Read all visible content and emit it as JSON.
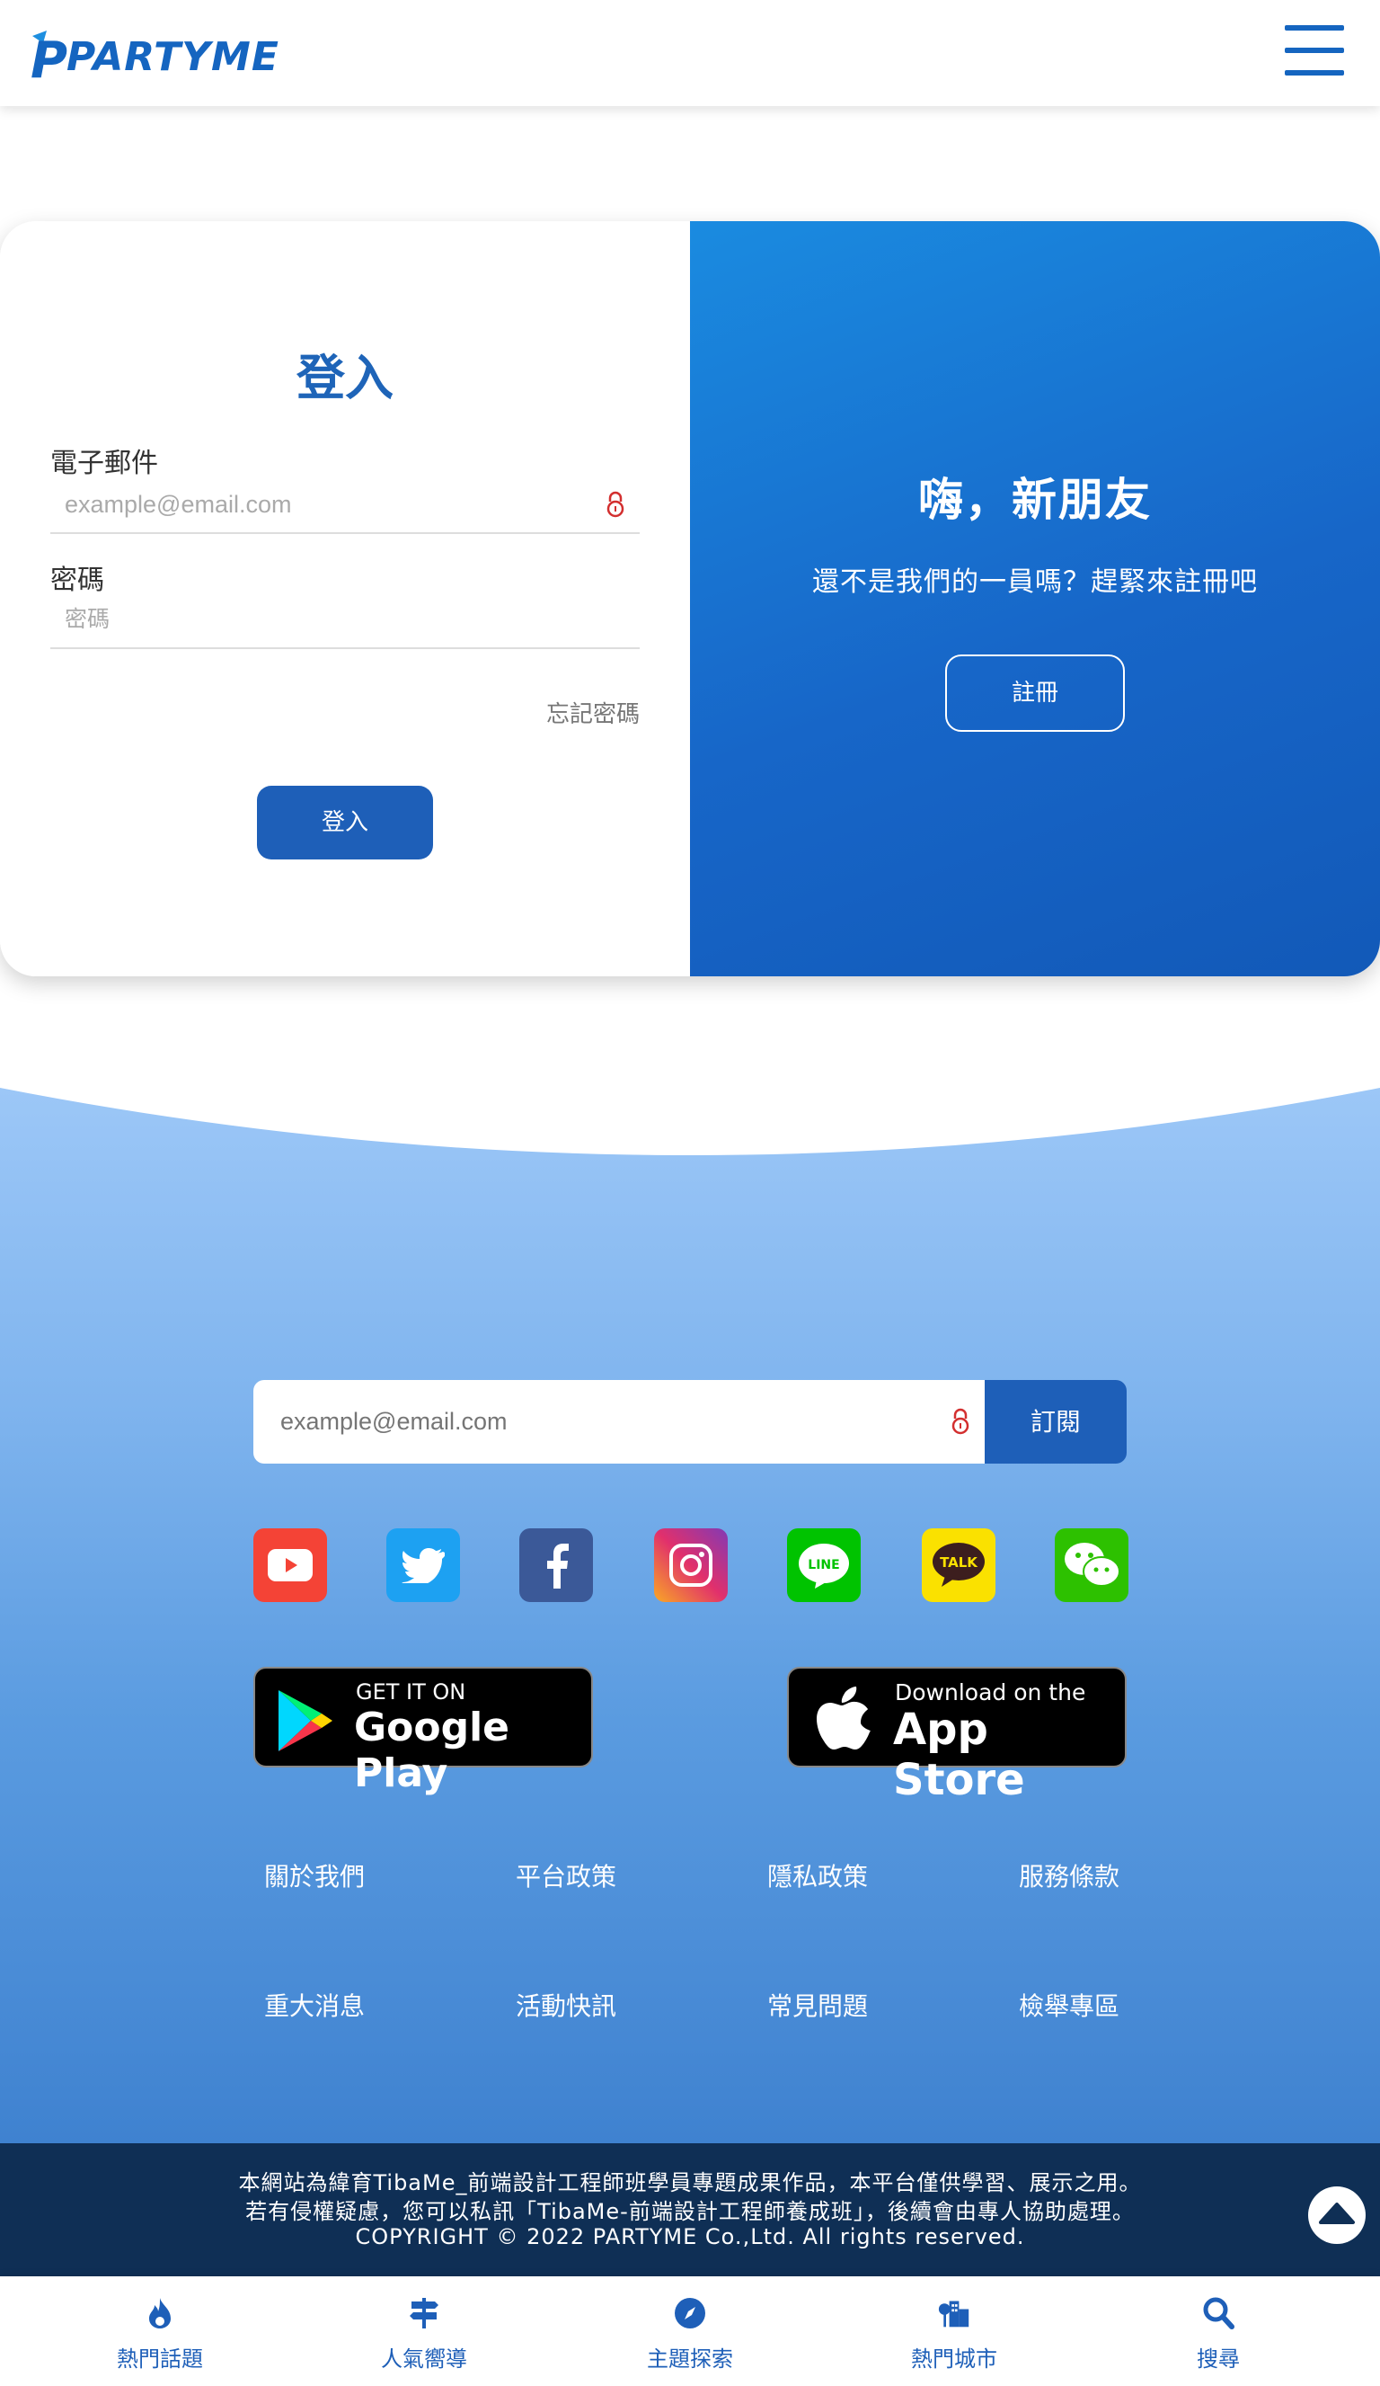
{
  "header": {
    "logo_text": "PARTYME",
    "menu_icon": "hamburger-menu-icon"
  },
  "login": {
    "title": "登入",
    "email_label": "電子郵件",
    "email_placeholder": "example@email.com",
    "password_label": "密碼",
    "password_placeholder": "密碼",
    "forgot_label": "忘記密碼",
    "login_button": "登入"
  },
  "welcome": {
    "title": "嗨，新朋友",
    "subtitle": "還不是我們的一員嗎？趕緊來註冊吧",
    "register_button": "註冊"
  },
  "subscribe": {
    "placeholder": "example@email.com",
    "button": "訂閱"
  },
  "social": [
    {
      "name": "youtube-icon",
      "color": "#f44336"
    },
    {
      "name": "twitter-icon",
      "color": "#1da1f2"
    },
    {
      "name": "facebook-icon",
      "color": "#3b5998"
    },
    {
      "name": "instagram-icon",
      "color": "#c13584"
    },
    {
      "name": "line-icon",
      "color": "#00c300"
    },
    {
      "name": "kakaotalk-icon",
      "color": "#fae100"
    },
    {
      "name": "wechat-icon",
      "color": "#2dc100"
    }
  ],
  "stores": {
    "google_small": "GET IT ON",
    "google_big": "Google Play",
    "apple_small": "Download on the",
    "apple_big": "App Store"
  },
  "footer_links": {
    "row1": [
      "關於我們",
      "平台政策",
      "隱私政策",
      "服務條款"
    ],
    "row2": [
      "重大消息",
      "活動快訊",
      "常見問題",
      "檢舉專區"
    ]
  },
  "copyright": {
    "line1": "本網站為緯育TibaMe_前端設計工程師班學員專題成果作品，本平台僅供學習、展示之用。",
    "line2": "若有侵權疑慮，您可以私訊「TibaMe-前端設計工程師養成班」，後續會由專人協助處理。",
    "line3": "COPYRIGHT © 2022 PARTYME Co.,Ltd. All rights reserved."
  },
  "bottom_nav": [
    {
      "label": "熱門話題",
      "icon": "fire-icon"
    },
    {
      "label": "人氣嚮導",
      "icon": "signpost-icon"
    },
    {
      "label": "主題探索",
      "icon": "compass-icon"
    },
    {
      "label": "熱門城市",
      "icon": "city-icon"
    },
    {
      "label": "搜尋",
      "icon": "search-icon"
    }
  ],
  "colors": {
    "brand": "#1e5fb8",
    "footer_dark": "#0f2f55"
  }
}
